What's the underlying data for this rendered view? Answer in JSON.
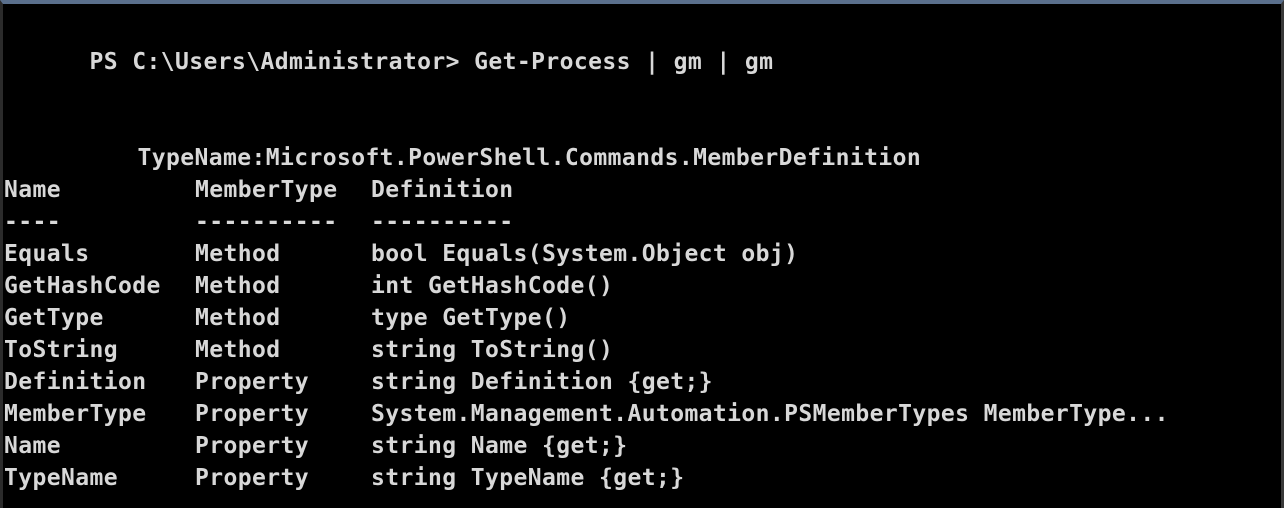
{
  "window": {
    "accent_color": "#5a6f8c",
    "background": "#000000",
    "text_color": "#d8d8d8"
  },
  "prompt": {
    "text": "PS C:\\Users\\Administrator> Get-Process | gm | gm"
  },
  "typename": {
    "text": "TypeName:Microsoft.PowerShell.Commands.MemberDefinition"
  },
  "table": {
    "headers": {
      "name": "Name",
      "membertype": "MemberType",
      "definition": "Definition"
    },
    "underlines": {
      "name": "----",
      "membertype": "----------",
      "definition": "----------"
    },
    "rows": [
      {
        "name": "Equals",
        "membertype": "Method",
        "definition": "bool Equals(System.Object obj)"
      },
      {
        "name": "GetHashCode",
        "membertype": "Method",
        "definition": "int GetHashCode()"
      },
      {
        "name": "GetType",
        "membertype": "Method",
        "definition": "type GetType()"
      },
      {
        "name": "ToString",
        "membertype": "Method",
        "definition": "string ToString()"
      },
      {
        "name": "Definition",
        "membertype": "Property",
        "definition": "string Definition {get;}"
      },
      {
        "name": "MemberType",
        "membertype": "Property",
        "definition": "System.Management.Automation.PSMemberTypes MemberType..."
      },
      {
        "name": "Name",
        "membertype": "Property",
        "definition": "string Name {get;}"
      },
      {
        "name": "TypeName",
        "membertype": "Property",
        "definition": "string TypeName {get;}"
      }
    ]
  }
}
